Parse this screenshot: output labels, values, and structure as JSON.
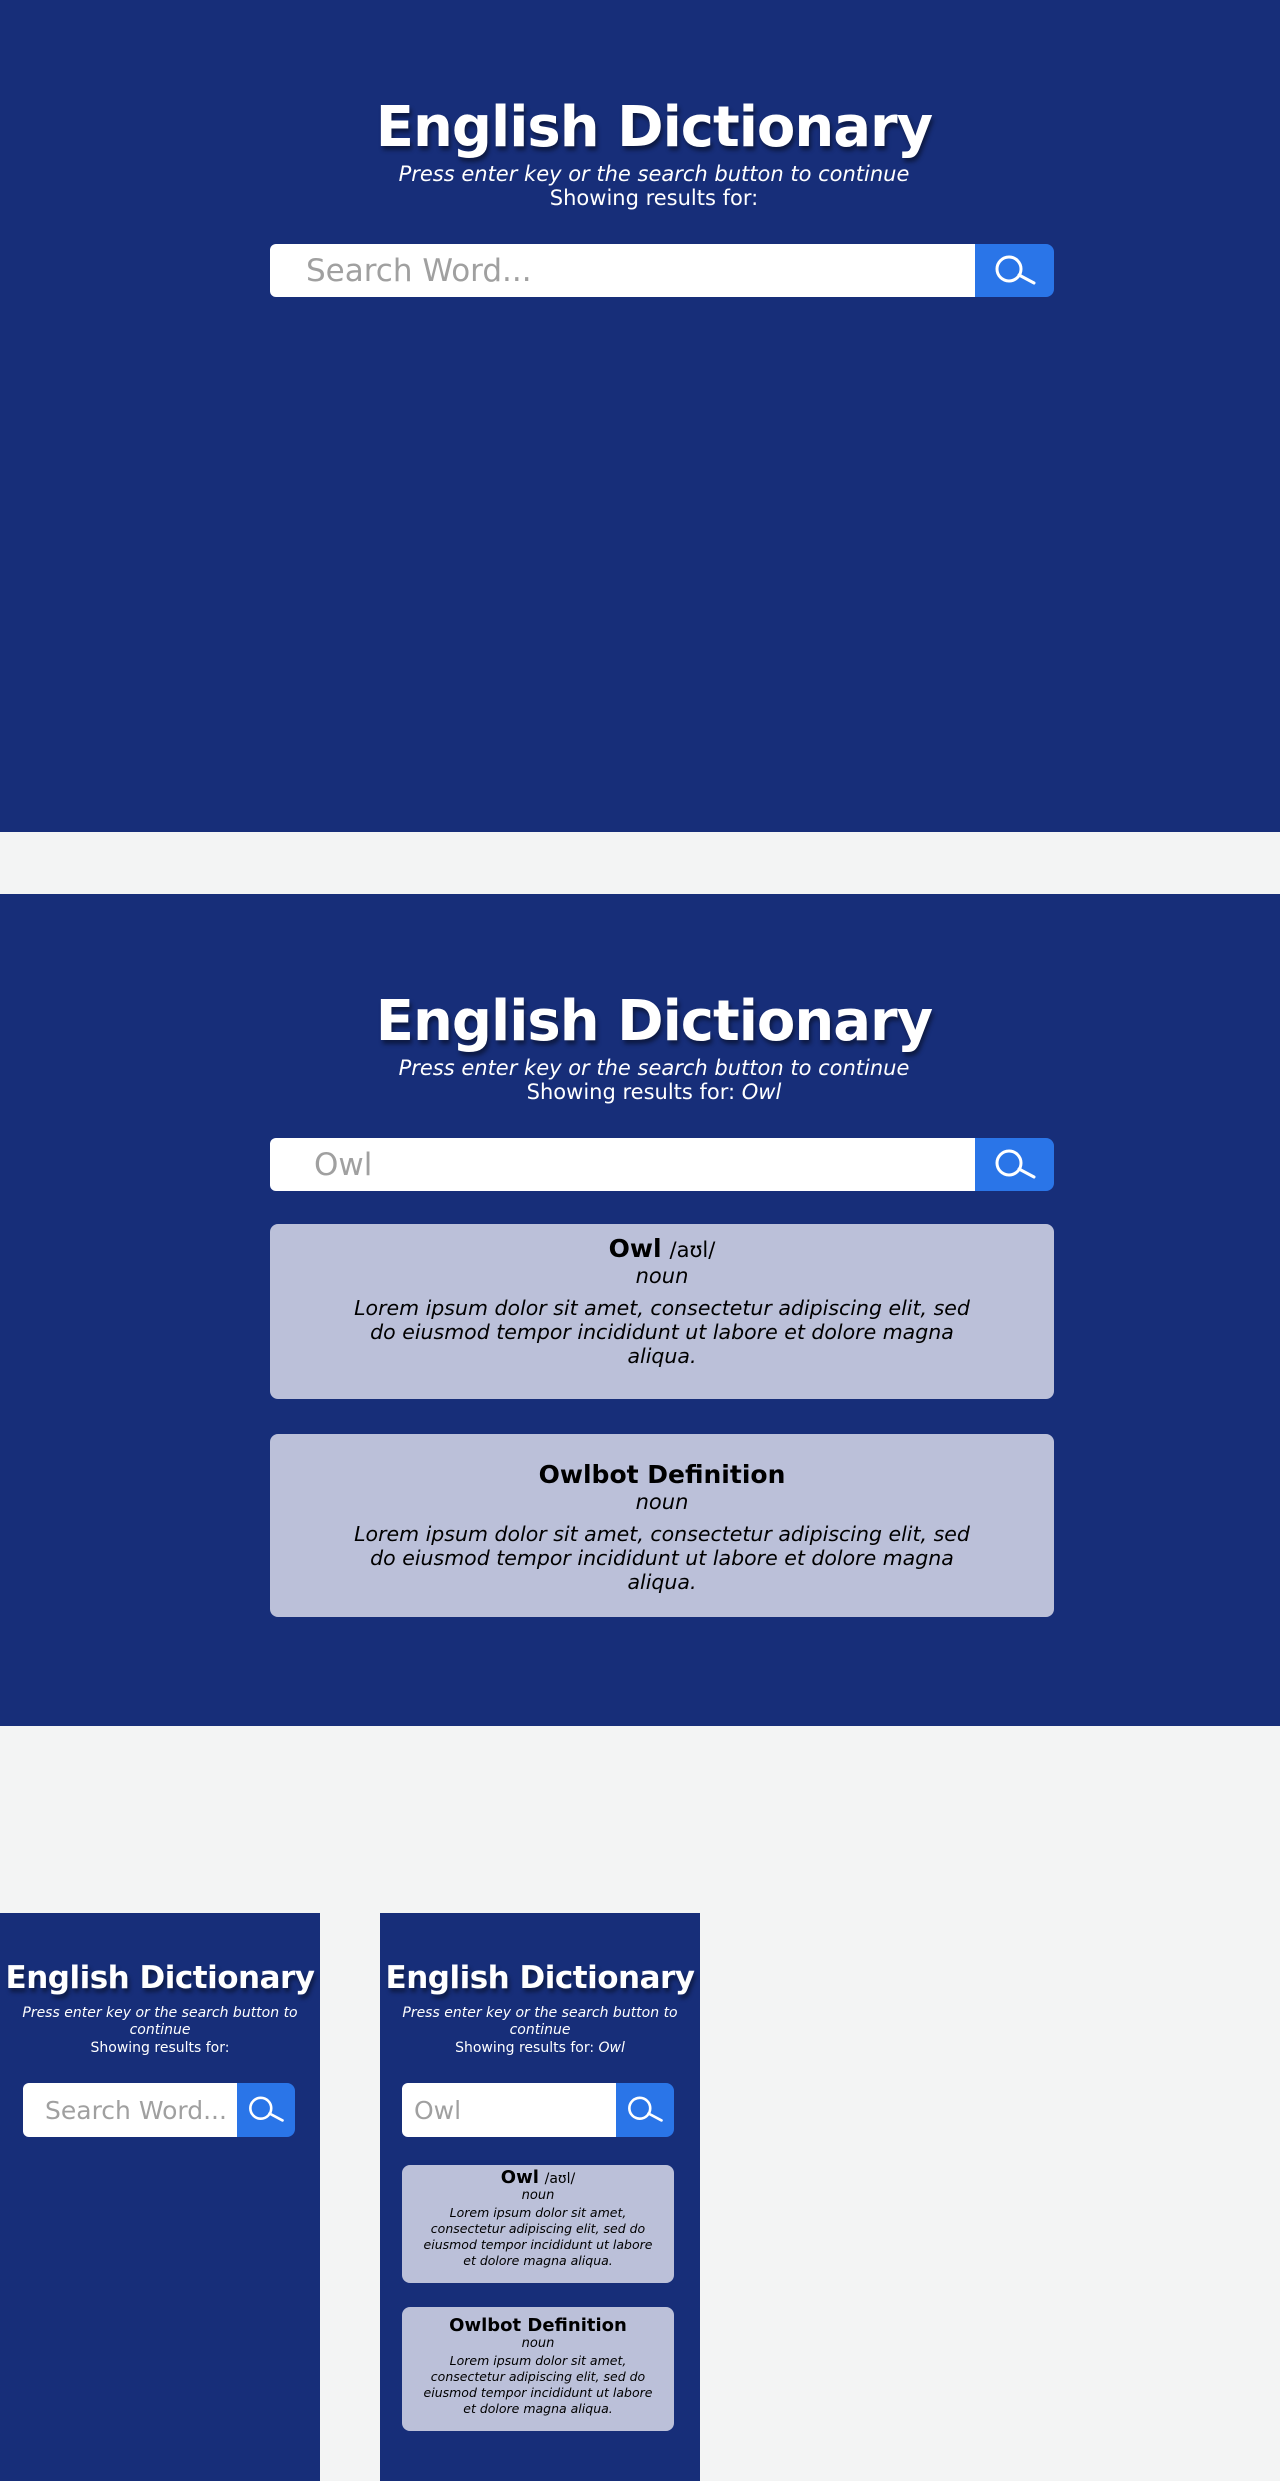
{
  "app_title": "English Dictionary",
  "hint": "Press enter key or the search button to continue",
  "results_prefix": "Showing results for:",
  "search": {
    "placeholder": "Search Word...",
    "query": "Owl"
  },
  "entry": {
    "word": "Owl",
    "phonetic": "/aʊl/",
    "part_of_speech": "noun",
    "definition": "Lorem ipsum dolor sit amet, consectetur adipiscing elit, sed do eiusmod tempor incididunt ut labore et dolore magna aliqua."
  },
  "owlbot": {
    "title": "Owlbot Definition",
    "part_of_speech": "noun",
    "definition": "Lorem ipsum dolor sit amet, consectetur adipiscing elit, sed do eiusmod tempor incididunt ut labore et dolore magna aliqua."
  },
  "colors": {
    "panel_bg": "#172e79",
    "page_bg": "#f3f4f4",
    "search_button": "#2a75e8",
    "card_bg": "#bbc0d9"
  },
  "icons": {
    "search_button": "search-icon"
  }
}
